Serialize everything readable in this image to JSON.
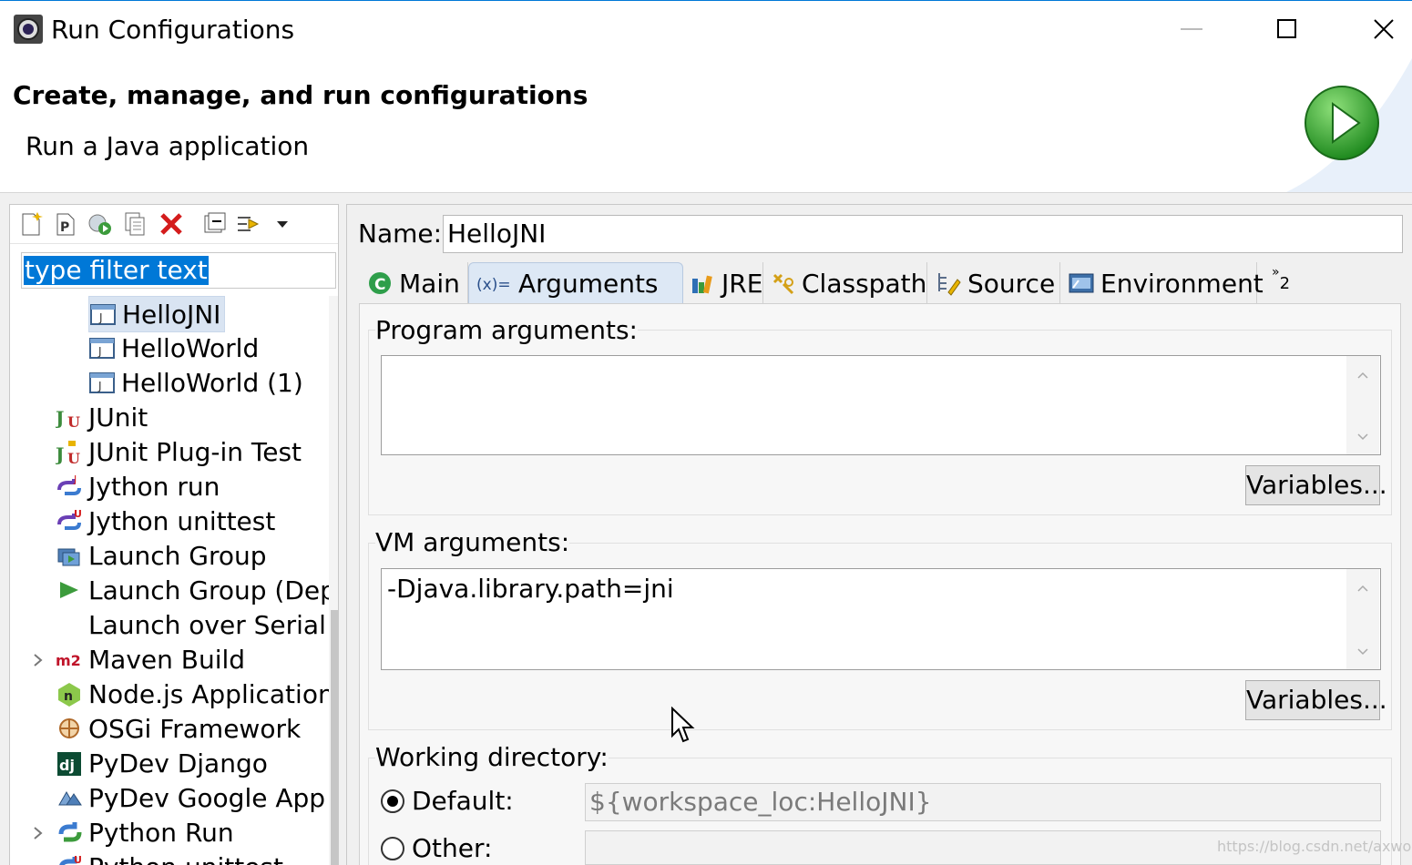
{
  "window": {
    "title": "Run Configurations"
  },
  "header": {
    "title": "Create, manage, and run configurations",
    "subtitle": "Run a Java application"
  },
  "left": {
    "filter_placeholder": "type filter text",
    "tree": [
      {
        "label": "HelloJNI",
        "icon": "java-app-icon",
        "selected": true
      },
      {
        "label": "HelloWorld",
        "icon": "java-app-icon"
      },
      {
        "label": "HelloWorld (1)",
        "icon": "java-app-icon"
      },
      {
        "label": "JUnit",
        "icon": "junit-icon"
      },
      {
        "label": "JUnit Plug-in Test",
        "icon": "junit-plugin-icon"
      },
      {
        "label": "Jython run",
        "icon": "jython-icon"
      },
      {
        "label": "Jython unittest",
        "icon": "jython-unittest-icon"
      },
      {
        "label": "Launch Group",
        "icon": "launch-group-icon"
      },
      {
        "label": "Launch Group (Depr",
        "icon": "launch-group-deprecated-icon"
      },
      {
        "label": "Launch over Serial",
        "icon": ""
      },
      {
        "label": "Maven Build",
        "icon": "maven-icon",
        "expander": true
      },
      {
        "label": "Node.js Application",
        "icon": "nodejs-icon"
      },
      {
        "label": "OSGi Framework",
        "icon": "osgi-icon"
      },
      {
        "label": "PyDev Django",
        "icon": "django-icon"
      },
      {
        "label": "PyDev Google App R",
        "icon": "google-app-icon"
      },
      {
        "label": "Python Run",
        "icon": "python-icon",
        "expander": true
      },
      {
        "label": "Python unittest",
        "icon": "python-unittest-icon"
      }
    ]
  },
  "right": {
    "name_label": "Name:",
    "name_value": "HelloJNI",
    "tabs": [
      "Main",
      "Arguments",
      "JRE",
      "Classpath",
      "Source",
      "Environment"
    ],
    "tabs_overflow": "2",
    "program_args_label": "Program arguments:",
    "program_args_value": "",
    "vm_args_label": "VM arguments:",
    "vm_args_value": "-Djava.library.path=jni",
    "variables_label": "Variables...",
    "working_dir_label": "Working directory:",
    "default_label": "Default:",
    "default_value": "${workspace_loc:HelloJNI}",
    "other_label": "Other:"
  },
  "watermark": "https://blog.csdn.net/axwolfer",
  "colors": {
    "selection": "#0078d7",
    "accent_blue": "#0078d7",
    "run_green": "#3fae3f"
  }
}
